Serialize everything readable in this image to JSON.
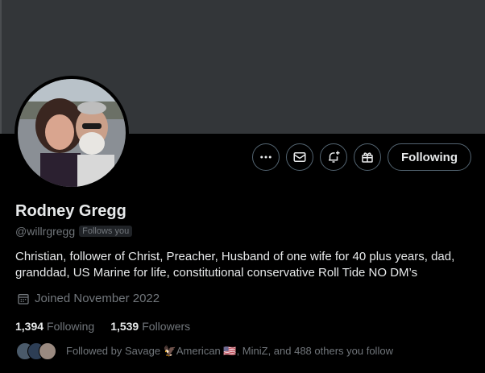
{
  "profile": {
    "name": "Rodney Gregg",
    "handle": "@willrgregg",
    "follows_you_badge": "Follows you",
    "bio": "Christian, follower of Christ, Preacher, Husband of one wife for 40 plus years, dad, granddad, US Marine for life, constitutional conservative Roll Tide NO DM’s",
    "joined": "Joined November 2022"
  },
  "actions": {
    "more_icon": "more-horizontal-icon",
    "message_icon": "mail-icon",
    "notify_icon": "bell-plus-icon",
    "subscribe_icon": "gift-icon",
    "following_label": "Following"
  },
  "stats": {
    "following_count": "1,394",
    "following_label": "Following",
    "followers_count": "1,539",
    "followers_label": "Followers"
  },
  "followed_by": {
    "text": "Followed by Savage 🦅American 🇺🇸, MiniZ, and 488 others you follow"
  },
  "colors": {
    "background": "#000000",
    "banner": "#333639",
    "text_primary": "#e7e9ea",
    "text_secondary": "#71767b",
    "border": "#536471"
  }
}
